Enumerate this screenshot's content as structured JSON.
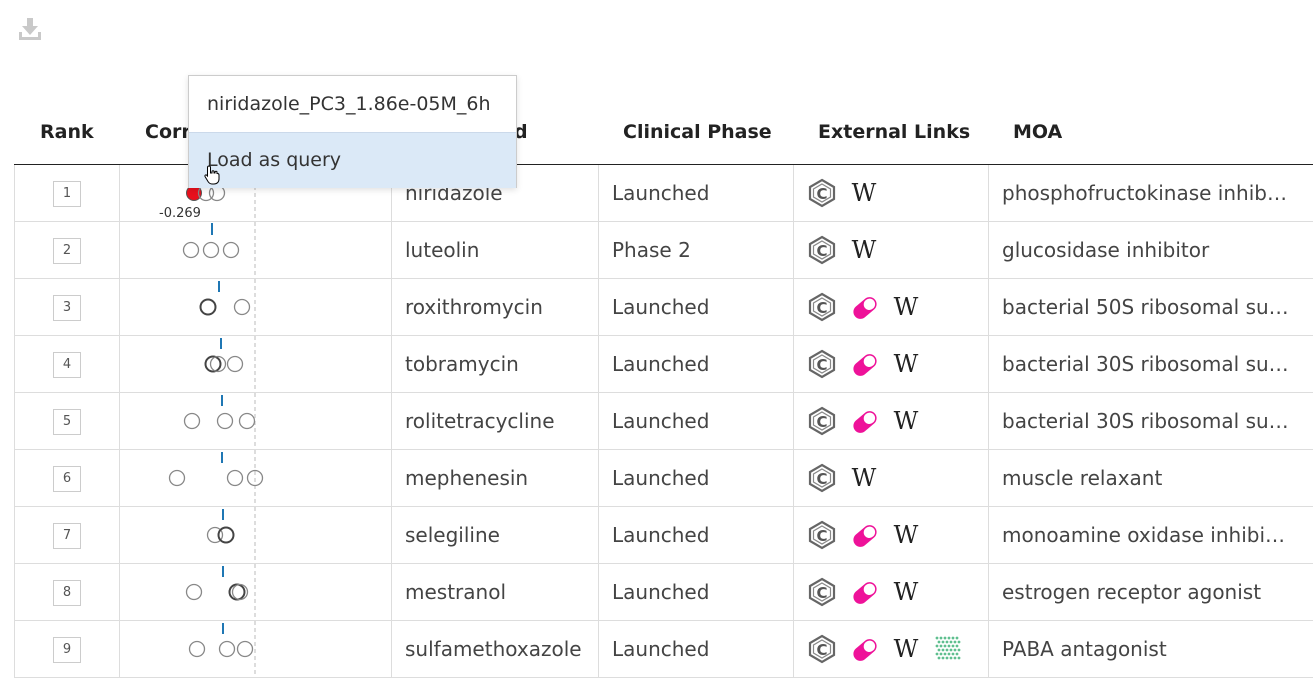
{
  "toolbar": {
    "download_icon": "download-icon"
  },
  "columns": [
    "Rank",
    "Corr",
    "d",
    "Clinical Phase",
    "External Links",
    "MOA"
  ],
  "popup": {
    "title": "niridazole_PC3_1.86e-05M_6h",
    "action_label": "Load as query"
  },
  "highlight_label": "-0.269",
  "colors": {
    "accent_red": "#e8101d",
    "pill_magenta": "#ee1299",
    "popup_bg": "#dbe9f7",
    "tick_blue": "#1f77b4"
  },
  "rows": [
    {
      "rank": "1",
      "name": "niridazole",
      "phase": "Launched",
      "links": [
        "chembl-icon",
        "wikipedia-icon"
      ],
      "moa": "phosphofructokinase inhibit..."
    },
    {
      "rank": "2",
      "name": "luteolin",
      "phase": "Phase 2",
      "links": [
        "chembl-icon",
        "wikipedia-icon"
      ],
      "moa": "glucosidase inhibitor"
    },
    {
      "rank": "3",
      "name": "roxithromycin",
      "phase": "Launched",
      "links": [
        "chembl-icon",
        "drugbank-pill-icon",
        "wikipedia-icon"
      ],
      "moa": "bacterial 50S ribosomal sub..."
    },
    {
      "rank": "4",
      "name": "tobramycin",
      "phase": "Launched",
      "links": [
        "chembl-icon",
        "drugbank-pill-icon",
        "wikipedia-icon"
      ],
      "moa": "bacterial 30S ribosomal sub..."
    },
    {
      "rank": "5",
      "name": "rolitetracycline",
      "phase": "Launched",
      "links": [
        "chembl-icon",
        "drugbank-pill-icon",
        "wikipedia-icon"
      ],
      "moa": "bacterial 30S ribosomal sub..."
    },
    {
      "rank": "6",
      "name": "mephenesin",
      "phase": "Launched",
      "links": [
        "chembl-icon",
        "wikipedia-icon"
      ],
      "moa": "muscle relaxant"
    },
    {
      "rank": "7",
      "name": "selegiline",
      "phase": "Launched",
      "links": [
        "chembl-icon",
        "drugbank-pill-icon",
        "wikipedia-icon"
      ],
      "moa": "monoamine oxidase inhibitor"
    },
    {
      "rank": "8",
      "name": "mestranol",
      "phase": "Launched",
      "links": [
        "chembl-icon",
        "drugbank-pill-icon",
        "wikipedia-icon"
      ],
      "moa": "estrogen receptor agonist"
    },
    {
      "rank": "9",
      "name": "sulfamethoxazole",
      "phase": "Launched",
      "links": [
        "chembl-icon",
        "drugbank-pill-icon",
        "wikipedia-icon",
        "molecule-icon"
      ],
      "moa": "PABA antagonist"
    }
  ]
}
